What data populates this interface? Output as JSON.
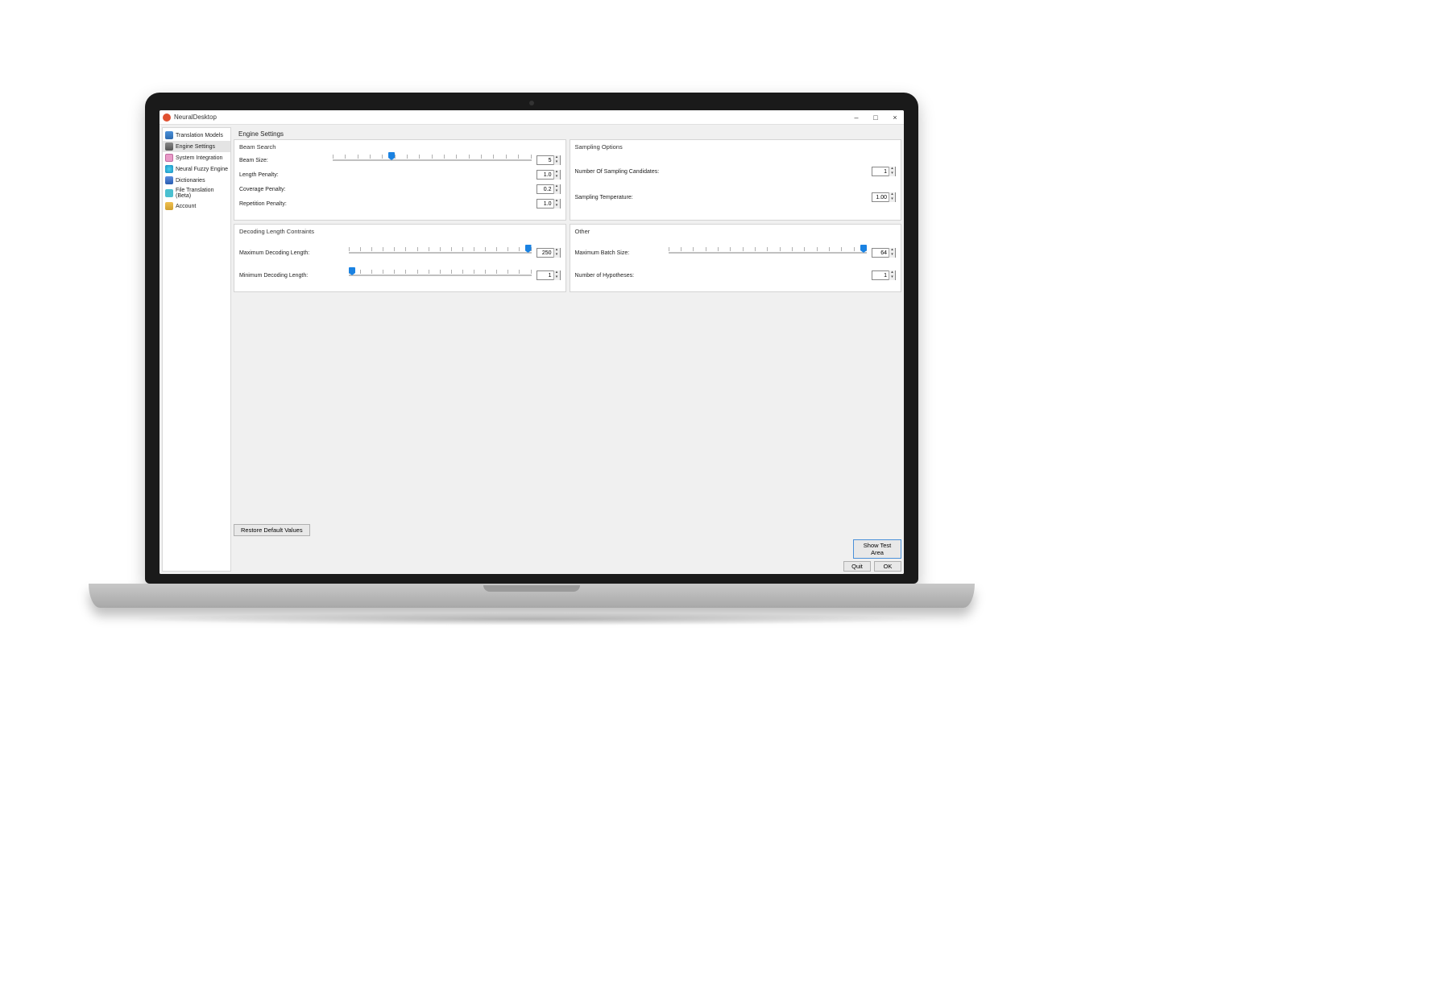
{
  "window": {
    "title": "NeuralDesktop",
    "minimize": "–",
    "maximize": "□",
    "close": "×"
  },
  "sidebar": {
    "items": [
      {
        "label": "Translation Models"
      },
      {
        "label": "Engine Settings"
      },
      {
        "label": "System Integration"
      },
      {
        "label": "Neural Fuzzy Engine"
      },
      {
        "label": "Dictionaries"
      },
      {
        "label": "File Translation (Beta)"
      },
      {
        "label": "Account"
      }
    ]
  },
  "page": {
    "title": "Engine Settings"
  },
  "beam_search": {
    "title": "Beam Search",
    "beam_size_label": "Beam Size:",
    "beam_size_value": "5",
    "length_penalty_label": "Length Penalty:",
    "length_penalty_value": "1.0",
    "coverage_penalty_label": "Coverage Penalty:",
    "coverage_penalty_value": "0.2",
    "repetition_penalty_label": "Repetition Penalty:",
    "repetition_penalty_value": "1.0"
  },
  "sampling": {
    "title": "Sampling Options",
    "candidates_label": "Number Of Sampling Candidates:",
    "candidates_value": "1",
    "temperature_label": "Sampling Temperature:",
    "temperature_value": "1.00"
  },
  "decoding": {
    "title": "Decoding Length Contraints",
    "max_label": "Maximum Decoding Length:",
    "max_value": "250",
    "min_label": "Minimum Decoding Length:",
    "min_value": "1"
  },
  "other": {
    "title": "Other",
    "batch_label": "Maximum Batch Size:",
    "batch_value": "64",
    "hypotheses_label": "Number of Hypotheses:",
    "hypotheses_value": "1"
  },
  "buttons": {
    "restore": "Restore Default Values",
    "show_test": "Show Test Area",
    "quit": "Quit",
    "ok": "OK"
  }
}
